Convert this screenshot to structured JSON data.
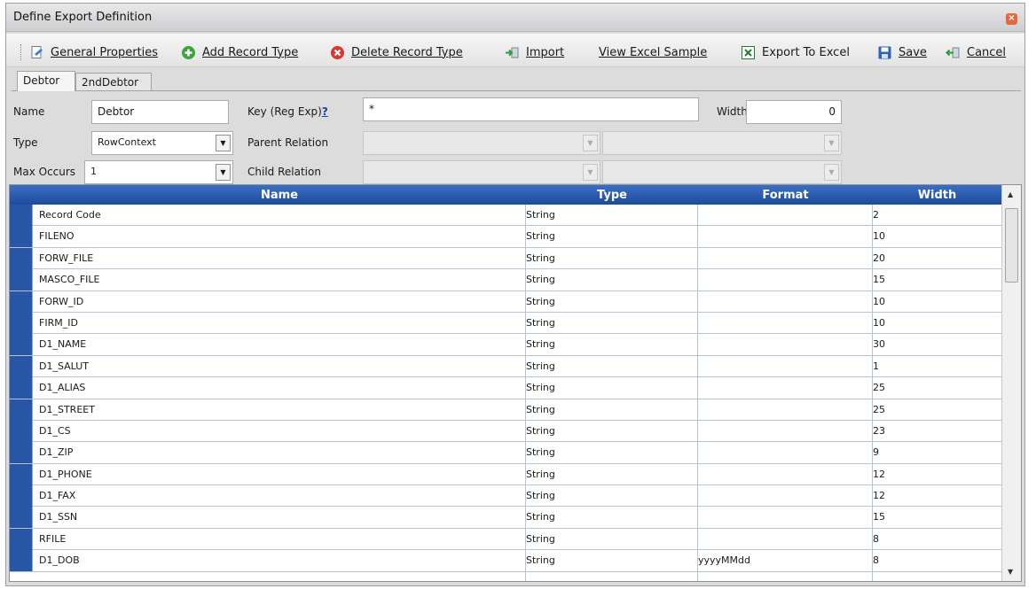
{
  "window": {
    "title": "Define Export Definition"
  },
  "toolbar": {
    "general_properties": "General Properties",
    "add_record_type": "Add Record Type",
    "delete_record_type": "Delete Record Type",
    "import": "Import",
    "view_excel_sample": "View Excel Sample",
    "export_to_excel": "Export To Excel",
    "save": "Save",
    "cancel": "Cancel"
  },
  "tabs": [
    "Debtor",
    "2ndDebtor"
  ],
  "form": {
    "name_label": "Name",
    "name_value": "Debtor",
    "key_label": "Key (Reg Exp)",
    "key_help": "?",
    "key_value": "*",
    "width_label": "Width",
    "width_value": "0",
    "type_label": "Type",
    "type_value": "RowContext",
    "parent_relation_label": "Parent Relation",
    "max_occurs_label": "Max Occurs",
    "max_occurs_value": "1",
    "child_relation_label": "Child Relation"
  },
  "grid": {
    "columns": [
      "Name",
      "Type",
      "Format",
      "Width"
    ],
    "rows": [
      [
        "Record Code",
        "String",
        "",
        "2"
      ],
      [
        "FILENO",
        "String",
        "",
        "10"
      ],
      [
        "FORW_FILE",
        "String",
        "",
        "20"
      ],
      [
        "MASCO_FILE",
        "String",
        "",
        "15"
      ],
      [
        "FORW_ID",
        "String",
        "",
        "10"
      ],
      [
        "FIRM_ID",
        "String",
        "",
        "10"
      ],
      [
        "D1_NAME",
        "String",
        "",
        "30"
      ],
      [
        "D1_SALUT",
        "String",
        "",
        "1"
      ],
      [
        "D1_ALIAS",
        "String",
        "",
        "25"
      ],
      [
        "D1_STREET",
        "String",
        "",
        "25"
      ],
      [
        "D1_CS",
        "String",
        "",
        "23"
      ],
      [
        "D1_ZIP",
        "String",
        "",
        "9"
      ],
      [
        "D1_PHONE",
        "String",
        "",
        "12"
      ],
      [
        "D1_FAX",
        "String",
        "",
        "12"
      ],
      [
        "D1_SSN",
        "String",
        "",
        "15"
      ],
      [
        "RFILE",
        "String",
        "",
        "8"
      ],
      [
        "D1_DOB",
        "String",
        "yyyyMMdd",
        "8"
      ]
    ]
  }
}
